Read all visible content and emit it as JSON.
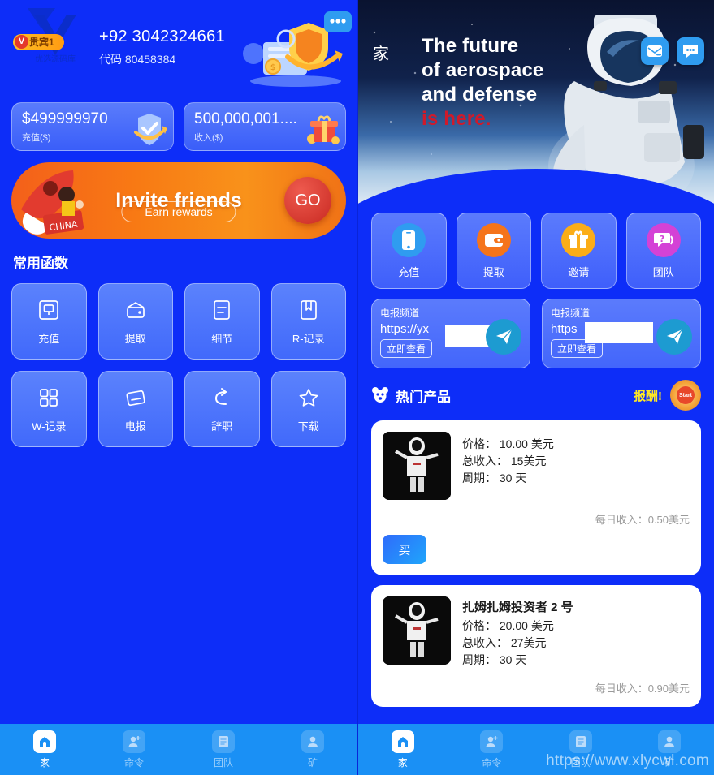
{
  "colors": {
    "background": "#0d2df8",
    "card": "#4d6efb",
    "tabbar": "#1a90f5",
    "reward_yellow": "#ffe924",
    "accent_orange": "#f5831f",
    "buy_blue": "#2f6bfb",
    "hero_red": "#cf1a2b"
  },
  "left": {
    "profile": {
      "vip_badge": "贵宾1",
      "phone": "+92 3042324661",
      "invite_code": "代码 80458384"
    },
    "balances": [
      {
        "value": "$499999970",
        "label": "充值($)",
        "icon": "shield-check-icon"
      },
      {
        "value": "500,000,001....",
        "label": "收入($)",
        "icon": "gift-box-icon"
      }
    ],
    "invite_banner": {
      "title": "Invite friends",
      "subtitle": "Earn rewards",
      "go_label": "GO"
    },
    "section_title": "常用函数",
    "functions": [
      {
        "label": "充值",
        "icon": "recharge-icon"
      },
      {
        "label": "提取",
        "icon": "wallet-icon"
      },
      {
        "label": "细节",
        "icon": "details-icon"
      },
      {
        "label": "R-记录",
        "icon": "bookmark-icon"
      },
      {
        "label": "W-记录",
        "icon": "grid-icon"
      },
      {
        "label": "电报",
        "icon": "telegram-card-icon"
      },
      {
        "label": "辞职",
        "icon": "resign-arrow-icon"
      },
      {
        "label": "下载",
        "icon": "star-icon"
      }
    ],
    "tabs": [
      {
        "label": "家",
        "icon": "home-icon",
        "active": true
      },
      {
        "label": "命令",
        "icon": "user-plus-icon",
        "active": false
      },
      {
        "label": "团队",
        "icon": "document-icon",
        "active": false
      },
      {
        "label": "矿",
        "icon": "person-icon",
        "active": false
      }
    ]
  },
  "right": {
    "hero": {
      "home_label": "家",
      "line1": "The future",
      "line2": "of aerospace",
      "line3": "and defense",
      "line4": "is here.",
      "icons": [
        {
          "name": "mail-icon"
        },
        {
          "name": "chat-icon"
        }
      ]
    },
    "quick_actions": [
      {
        "label": "充值",
        "icon": "phone-icon",
        "color": "#2f9cf0"
      },
      {
        "label": "提取",
        "icon": "wallet-icon",
        "color": "#f5741b"
      },
      {
        "label": "邀请",
        "icon": "gift-icon",
        "color": "#fbad18"
      },
      {
        "label": "团队",
        "icon": "question-chat-icon",
        "color": "#d442d6"
      }
    ],
    "telegram_cards": [
      {
        "title": "电报频道",
        "url": "https://yx",
        "url_redacted": true,
        "button": "立即查看",
        "icon": "telegram-icon"
      },
      {
        "title": "电报频道",
        "url": "https",
        "url_redacted": true,
        "button": "立即查看",
        "icon": "telegram-icon"
      }
    ],
    "hot_section": {
      "icon": "panda-icon",
      "title": "热门产品",
      "reward_label": "报酬!",
      "start_badge": "Start"
    },
    "products": [
      {
        "name": "",
        "price_label": "价格：",
        "price": "10.00 美元",
        "total_label": "总收入：",
        "total": "15美元",
        "cycle_label": "周期：",
        "cycle": "30 天",
        "daily": "每日收入：0.50美元",
        "buy_label": "买"
      },
      {
        "name": "扎姆扎姆投资者 2 号",
        "price_label": "价格：",
        "price": "20.00 美元",
        "total_label": "总收入：",
        "total": "27美元",
        "cycle_label": "周期：",
        "cycle": "30 天",
        "daily": "每日收入：0.90美元",
        "buy_label": "买"
      }
    ],
    "tabs": [
      {
        "label": "家",
        "icon": "home-icon",
        "active": true
      },
      {
        "label": "命令",
        "icon": "user-plus-icon",
        "active": false
      },
      {
        "label": "团队",
        "icon": "document-icon",
        "active": false
      },
      {
        "label": "矿",
        "icon": "person-icon",
        "active": false
      }
    ],
    "watermark": "https://www.xlycwl.com"
  }
}
